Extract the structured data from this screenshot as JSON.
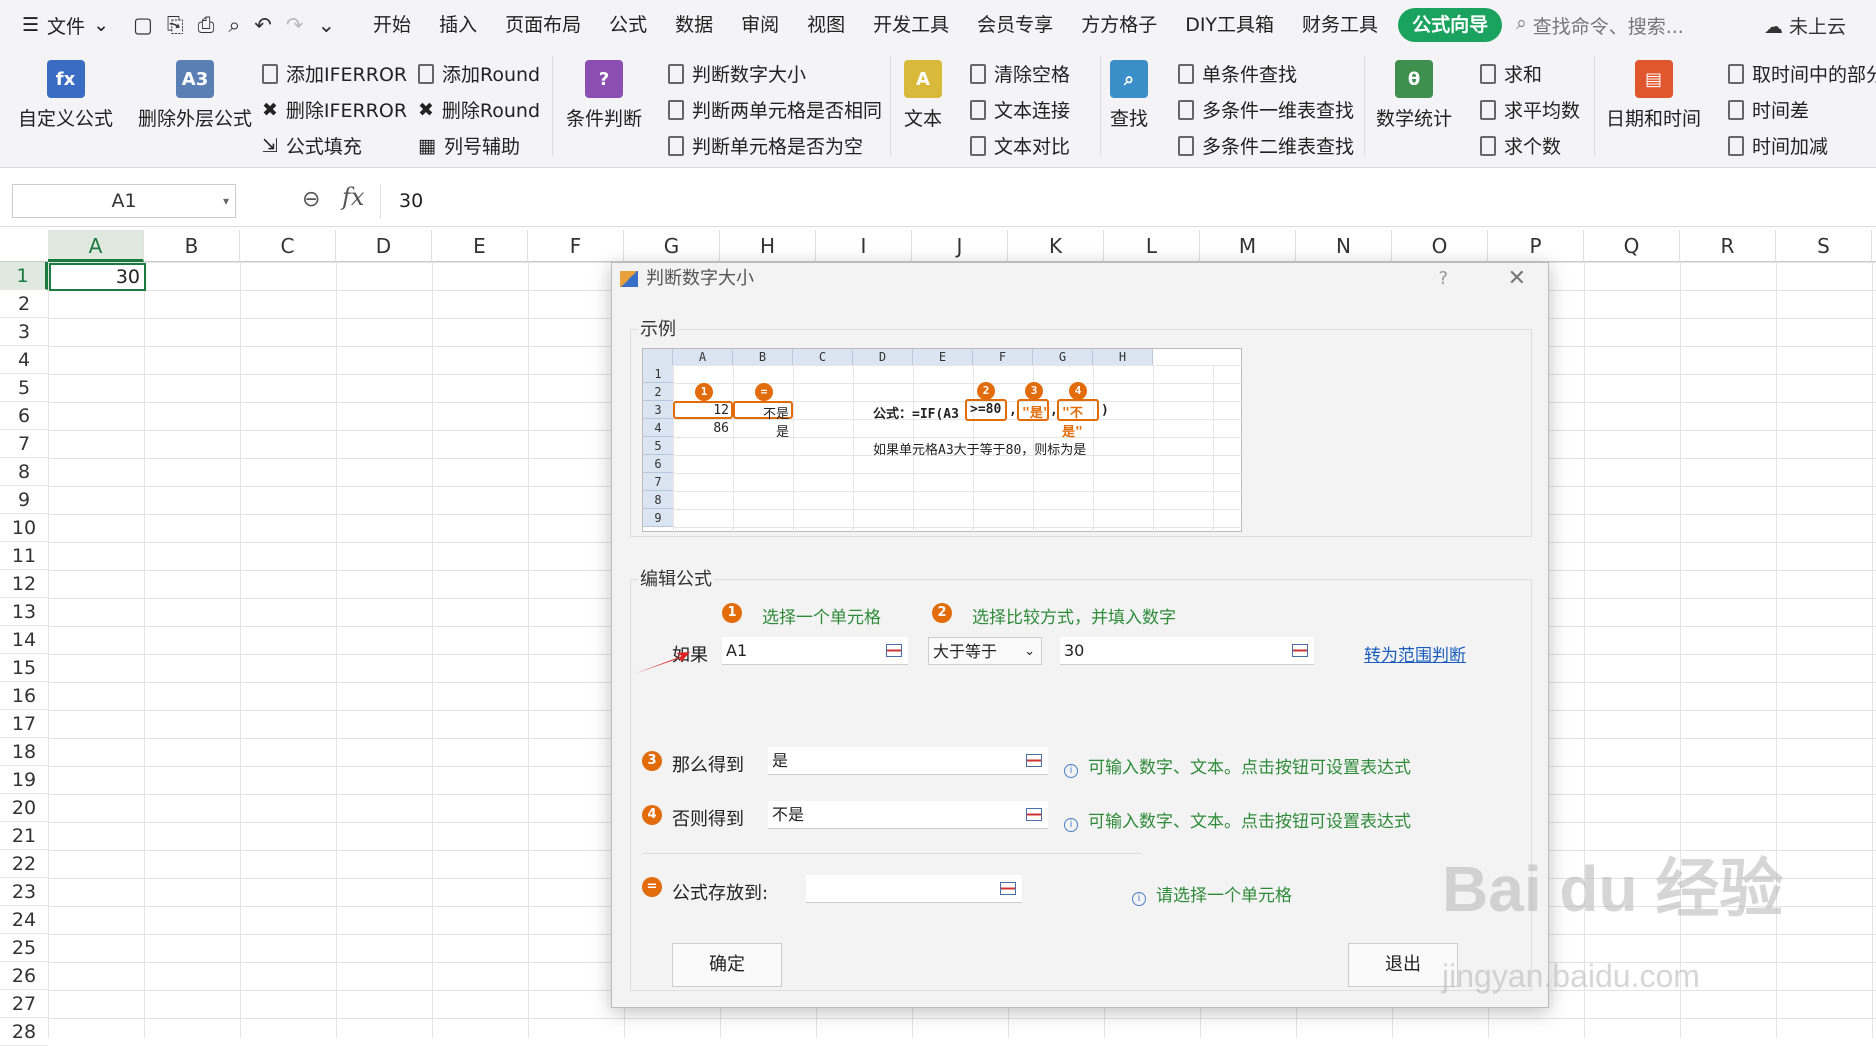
{
  "menubar": {
    "file_label": "文件",
    "tabs": [
      "开始",
      "插入",
      "页面布局",
      "公式",
      "数据",
      "审阅",
      "视图",
      "开发工具",
      "会员专享",
      "方方格子",
      "DIY工具箱",
      "财务工具"
    ],
    "active_tab": "公式向导",
    "search_placeholder": "查找命令、搜索...",
    "cloud_label": "未上云"
  },
  "ribbon": {
    "custom_formula": "自定义公式",
    "remove_outer": "删除外层公式",
    "add_iferror": "添加IFERROR",
    "del_iferror": "删除IFERROR",
    "formula_fill": "公式填充",
    "add_round": "添加Round",
    "del_round": "删除Round",
    "col_helper": "列号辅助",
    "cond_judge": "条件判断",
    "judge_size": "判断数字大小",
    "judge_same": "判断两单元格是否相同",
    "judge_empty": "判断单元格是否为空",
    "text": "文本",
    "clear_space": "清除空格",
    "text_join": "文本连接",
    "text_compare": "文本对比",
    "find": "查找",
    "single_find": "单条件查找",
    "multi_1d": "多条件一维表查找",
    "multi_2d": "多条件二维表查找",
    "math_stat": "数学统计",
    "sum": "求和",
    "avg": "求平均数",
    "count": "求个数",
    "datetime": "日期和时间",
    "time_part": "取时间中的部分",
    "time_diff": "时间差",
    "time_add": "时间加减"
  },
  "formula_bar": {
    "namebox": "A1",
    "value": "30"
  },
  "sheet": {
    "columns": [
      "A",
      "B",
      "C",
      "D",
      "E",
      "F",
      "G",
      "H",
      "I",
      "J",
      "K",
      "L",
      "M",
      "N",
      "O",
      "P",
      "Q",
      "R",
      "S"
    ],
    "rows": [
      "1",
      "2",
      "3",
      "4",
      "5",
      "6",
      "7",
      "8",
      "9",
      "10",
      "11",
      "12",
      "13",
      "14",
      "15",
      "16",
      "17",
      "18",
      "19",
      "20",
      "21",
      "22",
      "23",
      "24",
      "25",
      "26",
      "27",
      "28"
    ],
    "a1_value": "30"
  },
  "dialog": {
    "title": "判断数字大小",
    "help": "?",
    "example_label": "示例",
    "example": {
      "cols": [
        "A",
        "B",
        "C",
        "D",
        "E",
        "F",
        "G",
        "H"
      ],
      "rows": [
        "1",
        "2",
        "3",
        "4",
        "5",
        "6",
        "7",
        "8",
        "9"
      ],
      "a3": "12",
      "b3": "不是",
      "a4": "86",
      "b4": "是",
      "formula_prefix": "公式：=IF(A3",
      "formula_cond": ">=80",
      "comma1": ",",
      "formula_yes": "\"是\"",
      "comma2": ",",
      "formula_no": "\"不是\"",
      "formula_end": ")",
      "explain": "如果单元格A3大于等于80，则标为是",
      "badges": [
        "1",
        "=",
        "2",
        "3",
        "4"
      ]
    },
    "edit_label": "编辑公式",
    "step1": "选择一个单元格",
    "step2": "选择比较方式，并填入数字",
    "if_label": "如果",
    "cell_input": "A1",
    "compare": "大于等于",
    "number_input": "30",
    "range_link": "转为范围判断",
    "then_label": "那么得到",
    "then_value": "是",
    "else_label": "否则得到",
    "else_value": "不是",
    "hint": "可输入数字、文本。点击按钮可设置表达式",
    "store_label": "公式存放到:",
    "store_hint": "请选择一个单元格",
    "step_badges": [
      "1",
      "2",
      "3",
      "4",
      "="
    ],
    "ok": "确定",
    "exit": "退出"
  },
  "watermark": {
    "main": "Bai du 经验",
    "sub": "jingyan.baidu.com"
  }
}
